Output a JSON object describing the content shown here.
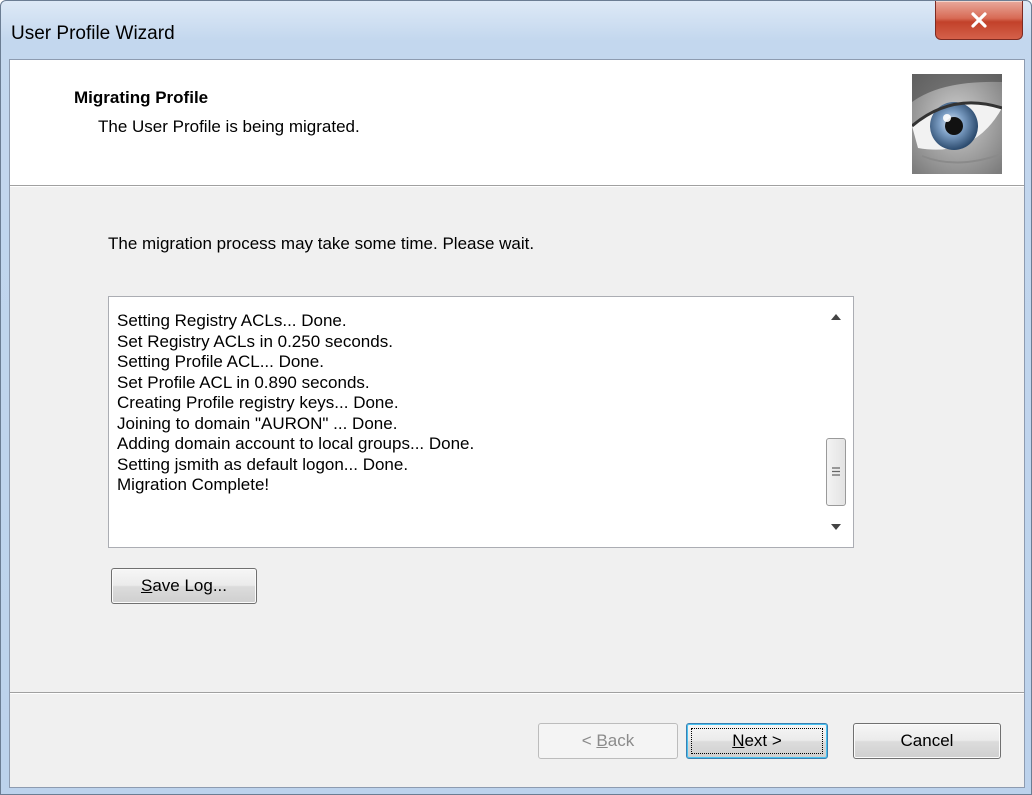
{
  "window": {
    "title": "User Profile Wizard"
  },
  "header": {
    "title": "Migrating Profile",
    "subtitle": "The User Profile is being migrated."
  },
  "main": {
    "intro_text": "The migration process may take some time. Please wait.",
    "log_lines": [
      "Setting Registry ACLs... Done.",
      "Set Registry ACLs in 0.250 seconds.",
      "Setting Profile ACL... Done.",
      "Set Profile ACL in 0.890 seconds.",
      "Creating Profile registry keys... Done.",
      "Joining to domain \"AURON\" ... Done.",
      "Adding domain account to local groups... Done.",
      "Setting jsmith as default logon... Done.",
      "Migration Complete!"
    ],
    "save_log": {
      "mnemonic": "S",
      "rest": "ave Log..."
    }
  },
  "footer": {
    "back": {
      "prefix": "< ",
      "mnemonic": "B",
      "rest": "ack",
      "enabled": false
    },
    "next": {
      "mnemonic": "N",
      "rest": "ext >",
      "is_default": true
    },
    "cancel": {
      "label": "Cancel"
    }
  },
  "icons": {
    "close": "close-icon",
    "header_image": "eye-image",
    "scroll_up": "scroll-up-arrow-icon",
    "scroll_down": "scroll-down-arrow-icon",
    "scroll_thumb_grip": "grip-icon"
  },
  "colors": {
    "close_button": "#c94a35",
    "dialog_background": "#f0f0f0",
    "default_button_border": "#3c7fb1",
    "disabled_text": "#8b8b8b"
  }
}
